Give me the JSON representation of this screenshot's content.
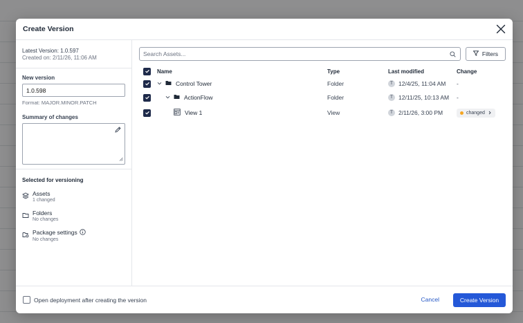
{
  "dialog": {
    "title": "Create Version",
    "left": {
      "latest_version": "Latest Version: 1.0.597",
      "created_on": "Created on: 2/11/26, 11:06 AM",
      "new_version_label": "New version",
      "new_version_value": "1.0.598",
      "format_hint": "Format: MAJOR.MINOR.PATCH",
      "summary_label": "Summary of changes",
      "selected_title": "Selected for versioning",
      "selected_items": [
        {
          "name": "Assets",
          "sub": "1 changed",
          "icon": "stack-icon"
        },
        {
          "name": "Folders",
          "sub": "No changes",
          "icon": "folder-outline-icon"
        },
        {
          "name": "Package settings",
          "sub": "No changes",
          "icon": "package-settings-icon"
        }
      ]
    },
    "search": {
      "placeholder": "Search Assets..."
    },
    "filters_label": "Filters",
    "table": {
      "headers": {
        "name": "Name",
        "type": "Type",
        "modified": "Last modified",
        "change": "Change"
      },
      "rows": [
        {
          "name": "Control Tower",
          "type": "Folder",
          "avatar": "T",
          "modified": "12/4/25, 11:04 AM",
          "change": "-",
          "checked": true
        },
        {
          "name": "ActionFlow",
          "type": "Folder",
          "avatar": "T",
          "modified": "12/11/25, 10:13 AM",
          "change": "-",
          "checked": true
        },
        {
          "name": "View 1",
          "type": "View",
          "avatar": "T",
          "modified": "2/11/26, 3:00 PM",
          "change": "changed",
          "checked": true
        }
      ]
    },
    "footer": {
      "open_deployment_label": "Open deployment after creating the version",
      "cancel_label": "Cancel",
      "create_label": "Create Version"
    }
  },
  "colors": {
    "primary": "#2458d8",
    "checkbox": "#1e2a4a",
    "changed_dot": "#f5a623"
  }
}
